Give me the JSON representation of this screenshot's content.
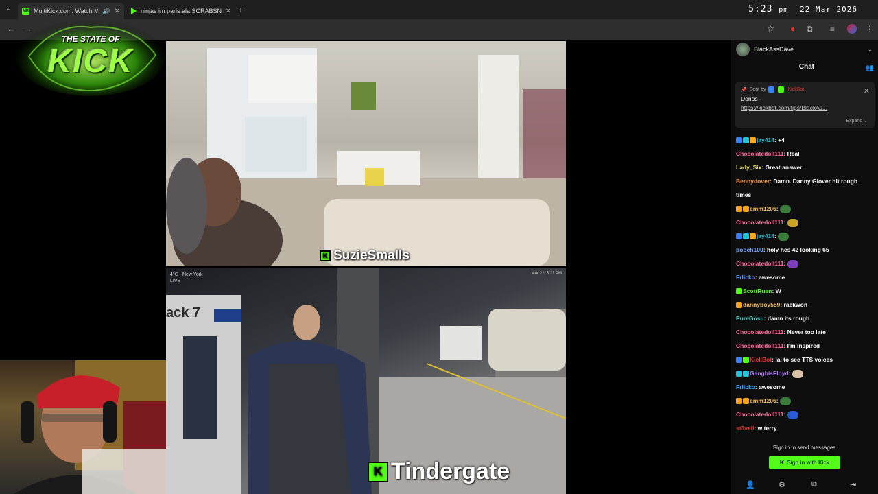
{
  "browser": {
    "tabs": [
      {
        "title": "MultiKick.com: Watch Multi",
        "favicon": "MK"
      },
      {
        "title": "ninjas im paris ala SCRABSNYC"
      }
    ],
    "new_tab": "+",
    "clock": {
      "time": "5:23",
      "ampm": "pm",
      "date": "22 Mar 2026"
    }
  },
  "logo": {
    "line1": "THE STATE OF",
    "line2": "KICK"
  },
  "streams": {
    "top": {
      "name": "SuzieSmalls"
    },
    "bottom": {
      "name": "Tindergate",
      "stamp_left": "4°C · New York\nLIVE",
      "stamp_right": "Mar 22, 5:23 PM",
      "sign": "ack 7"
    }
  },
  "chat": {
    "streamer": "BlackAssDave",
    "title": "Chat",
    "pinned": {
      "sent_by": "Sent by",
      "sender": "KickBot",
      "body": "Donos -",
      "link": "https://kickbot.com/tips/BlackAs...",
      "expand": "Expand"
    },
    "messages": [
      {
        "user": "jay414",
        "color": "#22c1d6",
        "badges": [
          "b-blue",
          "b-cyan",
          "b-gold"
        ],
        "text": "+4"
      },
      {
        "user": "Chocolatedoll111",
        "color": "#ff6b9a",
        "badges": [],
        "text": "Real"
      },
      {
        "user": "Lady_Six",
        "color": "#e8e85a",
        "badges": [],
        "text": "Great answer"
      },
      {
        "user": "Bennydover",
        "color": "#f29a55",
        "badges": [],
        "text": "Damn. Danny Glover hit rough times",
        "wrap": true
      },
      {
        "user": "emm1206",
        "color": "#f5c26b",
        "badges": [
          "b-gold",
          "b-gold"
        ],
        "text": "",
        "emote": "#3a7d3a"
      },
      {
        "user": "Chocolatedoll111",
        "color": "#ff6b9a",
        "badges": [],
        "text": "",
        "emote": "#c9a227"
      },
      {
        "user": "jay414",
        "color": "#22c1d6",
        "badges": [
          "b-blue",
          "b-cyan",
          "b-gold"
        ],
        "text": "",
        "emote": "#3a7d3a"
      },
      {
        "user": "pooch100",
        "color": "#7aa7ff",
        "badges": [],
        "text": "holy hes 42 looking 65"
      },
      {
        "user": "Chocolatedoll111",
        "color": "#ff6b9a",
        "badges": [],
        "text": "",
        "emote": "#7b3fbf"
      },
      {
        "user": "Frlicko",
        "color": "#4aa3ff",
        "badges": [],
        "text": "awesome"
      },
      {
        "user": "ScottRuen",
        "color": "#53fc18",
        "badges": [
          "b-green"
        ],
        "text": "W"
      },
      {
        "user": "dannyboy559",
        "color": "#f5c26b",
        "badges": [
          "b-gold"
        ],
        "text": "raekwon"
      },
      {
        "user": "PureGosu",
        "color": "#5ad1c9",
        "badges": [],
        "text": "damn its rough"
      },
      {
        "user": "Chocolatedoll111",
        "color": "#ff6b9a",
        "badges": [],
        "text": "Never too late"
      },
      {
        "user": "Chocolatedoll111",
        "color": "#ff6b9a",
        "badges": [],
        "text": "I'm inspired"
      },
      {
        "user": "KickBot",
        "color": "#e53935",
        "badges": [
          "b-blue",
          "b-green"
        ],
        "text": "lai to see TTS voices"
      },
      {
        "user": "GenghisFloyd",
        "color": "#b57aff",
        "badges": [
          "b-cyan",
          "b-cyan"
        ],
        "text": "",
        "emote": "#d9c2a6"
      },
      {
        "user": "Frlicko",
        "color": "#4aa3ff",
        "badges": [],
        "text": "awesome"
      },
      {
        "user": "emm1206",
        "color": "#f5c26b",
        "badges": [
          "b-gold",
          "b-gold"
        ],
        "text": "",
        "emote": "#3a7d3a"
      },
      {
        "user": "Chocolatedoll111",
        "color": "#ff6b9a",
        "badges": [],
        "text": "",
        "emote": "#2a5bd7"
      },
      {
        "user": "st3vell",
        "color": "#e53935",
        "badges": [],
        "text": "w terry"
      }
    ],
    "footer_text": "Sign in to send messages",
    "signin_label": "Sign in with Kick"
  }
}
